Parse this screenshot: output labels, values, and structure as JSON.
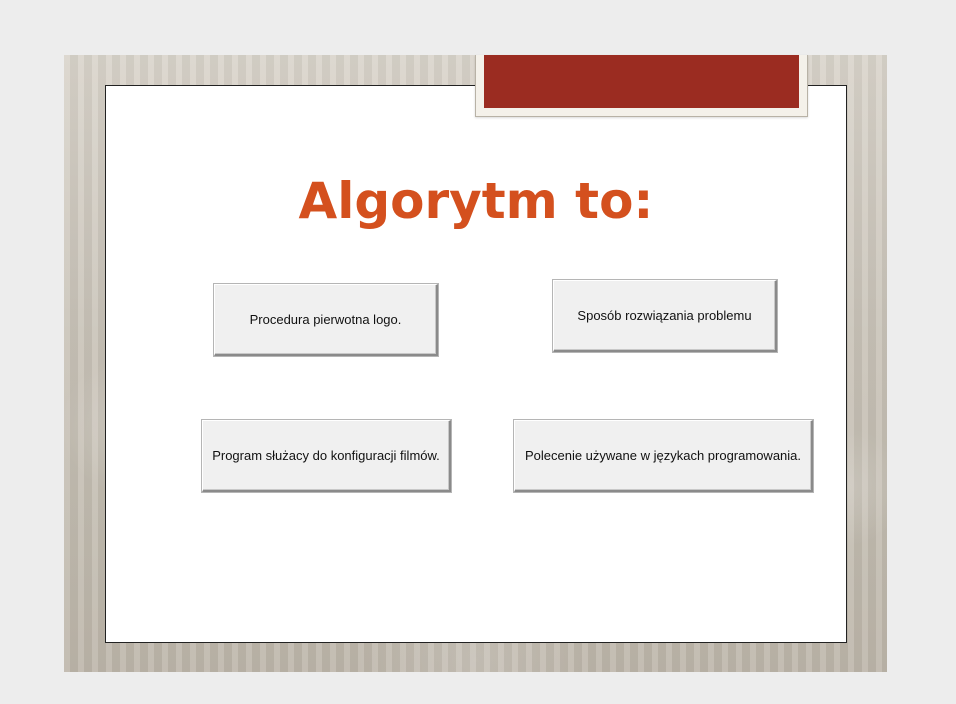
{
  "slide": {
    "title": "Algorytm to:"
  },
  "answers": [
    {
      "label": "Procedura pierwotna logo."
    },
    {
      "label": "Sposób rozwiązania problemu"
    },
    {
      "label": "Program służacy do konfiguracji filmów."
    },
    {
      "label": "Polecenie używane w językach programowania."
    }
  ],
  "colors": {
    "title": "#d4501e",
    "accent_tab": "#9b2c21",
    "background": "#ededed",
    "slide": "#ffffff",
    "button": "#f0f0f0"
  }
}
